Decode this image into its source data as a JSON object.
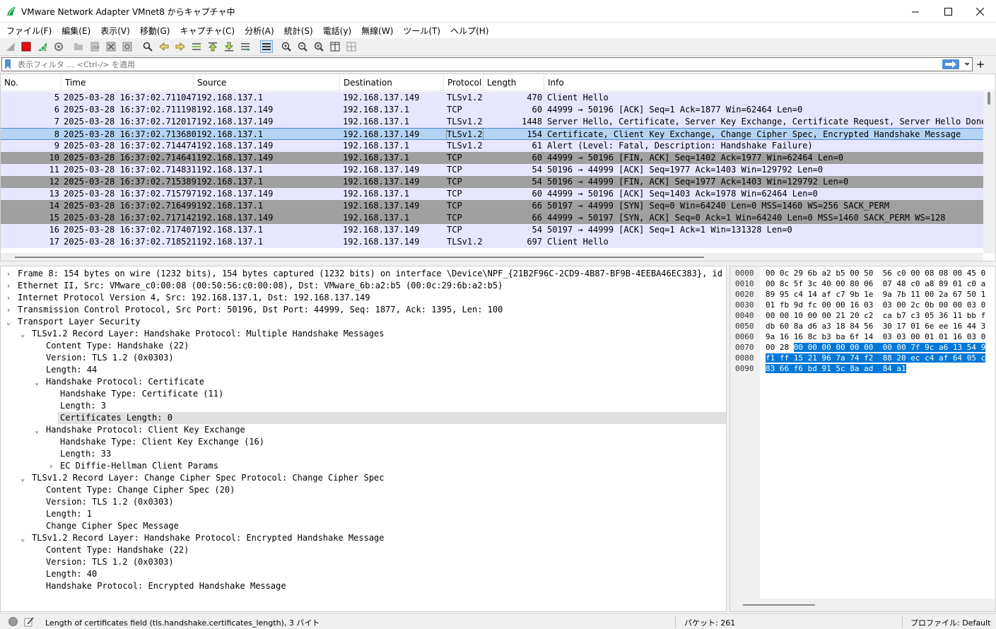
{
  "window": {
    "title": "VMware Network Adapter VMnet8 からキャプチャ中"
  },
  "menu": [
    "ファイル(F)",
    "編集(E)",
    "表示(V)",
    "移動(G)",
    "キャプチャ(C)",
    "分析(A)",
    "統計(S)",
    "電話(y)",
    "無線(W)",
    "ツール(T)",
    "ヘルプ(H)"
  ],
  "filter": {
    "placeholder": "表示フィルタ … <Ctrl-/> を適用",
    "add_label": "+"
  },
  "packet_list": {
    "columns": [
      "No.",
      "Time",
      "Source",
      "Destination",
      "Protocol",
      "Length",
      "Info"
    ],
    "rows": [
      {
        "no": "5",
        "time": "2025-03-28 16:37:02.711047",
        "src": "192.168.137.1",
        "dst": "192.168.137.149",
        "proto": "TLSv1.2",
        "len": "470",
        "info": "Client Hello"
      },
      {
        "no": "6",
        "time": "2025-03-28 16:37:02.711198",
        "src": "192.168.137.149",
        "dst": "192.168.137.1",
        "proto": "TCP",
        "len": "60",
        "info": "44999 → 50196 [ACK] Seq=1 Ack=1877 Win=62464 Len=0"
      },
      {
        "no": "7",
        "time": "2025-03-28 16:37:02.712017",
        "src": "192.168.137.149",
        "dst": "192.168.137.1",
        "proto": "TLSv1.2",
        "len": "1448",
        "info": "Server Hello, Certificate, Server Key Exchange, Certificate Request, Server Hello Done"
      },
      {
        "no": "8",
        "time": "2025-03-28 16:37:02.713680",
        "src": "192.168.137.1",
        "dst": "192.168.137.149",
        "proto": "TLSv1.2",
        "len": "154",
        "info": "Certificate, Client Key Exchange, Change Cipher Spec, Encrypted Handshake Message"
      },
      {
        "no": "9",
        "time": "2025-03-28 16:37:02.714474",
        "src": "192.168.137.149",
        "dst": "192.168.137.1",
        "proto": "TLSv1.2",
        "len": "61",
        "info": "Alert (Level: Fatal, Description: Handshake Failure)"
      },
      {
        "no": "10",
        "time": "2025-03-28 16:37:02.714641",
        "src": "192.168.137.149",
        "dst": "192.168.137.1",
        "proto": "TCP",
        "len": "60",
        "info": "44999 → 50196 [FIN, ACK] Seq=1402 Ack=1977 Win=62464 Len=0"
      },
      {
        "no": "11",
        "time": "2025-03-28 16:37:02.714831",
        "src": "192.168.137.1",
        "dst": "192.168.137.149",
        "proto": "TCP",
        "len": "54",
        "info": "50196 → 44999 [ACK] Seq=1977 Ack=1403 Win=129792 Len=0"
      },
      {
        "no": "12",
        "time": "2025-03-28 16:37:02.715389",
        "src": "192.168.137.1",
        "dst": "192.168.137.149",
        "proto": "TCP",
        "len": "54",
        "info": "50196 → 44999 [FIN, ACK] Seq=1977 Ack=1403 Win=129792 Len=0"
      },
      {
        "no": "13",
        "time": "2025-03-28 16:37:02.715797",
        "src": "192.168.137.149",
        "dst": "192.168.137.1",
        "proto": "TCP",
        "len": "60",
        "info": "44999 → 50196 [ACK] Seq=1403 Ack=1978 Win=62464 Len=0"
      },
      {
        "no": "14",
        "time": "2025-03-28 16:37:02.716499",
        "src": "192.168.137.1",
        "dst": "192.168.137.149",
        "proto": "TCP",
        "len": "66",
        "info": "50197 → 44999 [SYN] Seq=0 Win=64240 Len=0 MSS=1460 WS=256 SACK_PERM"
      },
      {
        "no": "15",
        "time": "2025-03-28 16:37:02.717142",
        "src": "192.168.137.149",
        "dst": "192.168.137.1",
        "proto": "TCP",
        "len": "66",
        "info": "44999 → 50197 [SYN, ACK] Seq=0 Ack=1 Win=64240 Len=0 MSS=1460 SACK_PERM WS=128"
      },
      {
        "no": "16",
        "time": "2025-03-28 16:37:02.717407",
        "src": "192.168.137.1",
        "dst": "192.168.137.149",
        "proto": "TCP",
        "len": "54",
        "info": "50197 → 44999 [ACK] Seq=1 Ack=1 Win=131328 Len=0"
      },
      {
        "no": "17",
        "time": "2025-03-28 16:37:02.718521",
        "src": "192.168.137.1",
        "dst": "192.168.137.149",
        "proto": "TLSv1.2",
        "len": "697",
        "info": "Client Hello"
      }
    ]
  },
  "details": [
    {
      "indent": 0,
      "exp": "›",
      "text": "Frame 8: 154 bytes on wire (1232 bits), 154 bytes captured (1232 bits) on interface \\Device\\NPF_{21B2F96C-2CD9-4B87-BF9B-4EEBA46EC383}, id 0"
    },
    {
      "indent": 0,
      "exp": "›",
      "text": "Ethernet II, Src: VMware_c0:00:08 (00:50:56:c0:00:08), Dst: VMware_6b:a2:b5 (00:0c:29:6b:a2:b5)"
    },
    {
      "indent": 0,
      "exp": "›",
      "text": "Internet Protocol Version 4, Src: 192.168.137.1, Dst: 192.168.137.149"
    },
    {
      "indent": 0,
      "exp": "›",
      "text": "Transmission Control Protocol, Src Port: 50196, Dst Port: 44999, Seq: 1877, Ack: 1395, Len: 100"
    },
    {
      "indent": 0,
      "exp": "⌄",
      "text": "Transport Layer Security"
    },
    {
      "indent": 1,
      "exp": "⌄",
      "text": "TLSv1.2 Record Layer: Handshake Protocol: Multiple Handshake Messages"
    },
    {
      "indent": 2,
      "exp": "",
      "text": "Content Type: Handshake (22)"
    },
    {
      "indent": 2,
      "exp": "",
      "text": "Version: TLS 1.2 (0x0303)"
    },
    {
      "indent": 2,
      "exp": "",
      "text": "Length: 44"
    },
    {
      "indent": 2,
      "exp": "⌄",
      "text": "Handshake Protocol: Certificate"
    },
    {
      "indent": 3,
      "exp": "",
      "text": "Handshake Type: Certificate (11)"
    },
    {
      "indent": 3,
      "exp": "",
      "text": "Length: 3"
    },
    {
      "indent": 3,
      "exp": "",
      "text": "Certificates Length: 0"
    },
    {
      "indent": 2,
      "exp": "⌄",
      "text": "Handshake Protocol: Client Key Exchange"
    },
    {
      "indent": 3,
      "exp": "",
      "text": "Handshake Type: Client Key Exchange (16)"
    },
    {
      "indent": 3,
      "exp": "",
      "text": "Length: 33"
    },
    {
      "indent": 3,
      "exp": "›",
      "text": "EC Diffie-Hellman Client Params"
    },
    {
      "indent": 1,
      "exp": "⌄",
      "text": "TLSv1.2 Record Layer: Change Cipher Spec Protocol: Change Cipher Spec"
    },
    {
      "indent": 2,
      "exp": "",
      "text": "Content Type: Change Cipher Spec (20)"
    },
    {
      "indent": 2,
      "exp": "",
      "text": "Version: TLS 1.2 (0x0303)"
    },
    {
      "indent": 2,
      "exp": "",
      "text": "Length: 1"
    },
    {
      "indent": 2,
      "exp": "",
      "text": "Change Cipher Spec Message"
    },
    {
      "indent": 1,
      "exp": "⌄",
      "text": "TLSv1.2 Record Layer: Handshake Protocol: Encrypted Handshake Message"
    },
    {
      "indent": 2,
      "exp": "",
      "text": "Content Type: Handshake (22)"
    },
    {
      "indent": 2,
      "exp": "",
      "text": "Version: TLS 1.2 (0x0303)"
    },
    {
      "indent": 2,
      "exp": "",
      "text": "Length: 40"
    },
    {
      "indent": 2,
      "exp": "",
      "text": "Handshake Protocol: Encrypted Handshake Message"
    }
  ],
  "bytes": {
    "offsets": [
      "0000",
      "0010",
      "0020",
      "0030",
      "0040",
      "0050",
      "0060",
      "0070",
      "0080",
      "0090"
    ],
    "lines": [
      {
        "plain": "00 0c 29 6b a2 b5 00 50  56 c0 00 08 08 00 45 0",
        "hl": ""
      },
      {
        "plain": "00 8c 5f 3c 40 00 80 06  07 48 c0 a8 89 01 c0 a",
        "hl": ""
      },
      {
        "plain": "89 95 c4 14 af c7 9b 1e  9a 7b 11 00 2a 67 50 1",
        "hl": ""
      },
      {
        "plain": "01 fb 9d fc 00 00 16 03  03 00 2c 0b 00 00 03 0",
        "hl": ""
      },
      {
        "plain": "00 00 10 00 00 21 20 c2  ca b7 c3 05 36 11 bb f",
        "hl": ""
      },
      {
        "plain": "db 60 8a d6 a3 18 84 56  30 17 01 6e ee 16 44 3",
        "hl": ""
      },
      {
        "plain": "9a 16 16 8c b3 ba 6f 14  03 03 00 01 01 16 03 0",
        "hl": ""
      },
      {
        "plain": "00 28 ",
        "hl": "00 00 00 00 00 00  00 00 7f 9c a6 13 54 9"
      },
      {
        "plain": "",
        "hl": "f1 ff 15 21 96 7a 74 f2  88 20 ec c4 af 64 05 c"
      },
      {
        "plain": "",
        "hl": "83 66 f6 bd 91 5c 8a ad  84 a1"
      }
    ]
  },
  "status": {
    "text": "Length of certificates field (tls.handshake.certificates_length), 3 バイト",
    "packets": "パケット: 261",
    "profile": "プロファイル: Default"
  }
}
